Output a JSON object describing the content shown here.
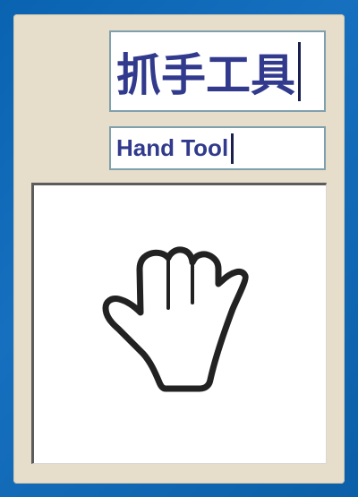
{
  "tool": {
    "name_zh": "抓手工具",
    "name_en": "Hand Tool",
    "icon": "hand-icon"
  },
  "colors": {
    "background": "#0a63b0",
    "panel": "#e6ddca",
    "field_border": "#7fa0ad",
    "text": "#313a8c",
    "icon_stroke": "#222222"
  }
}
